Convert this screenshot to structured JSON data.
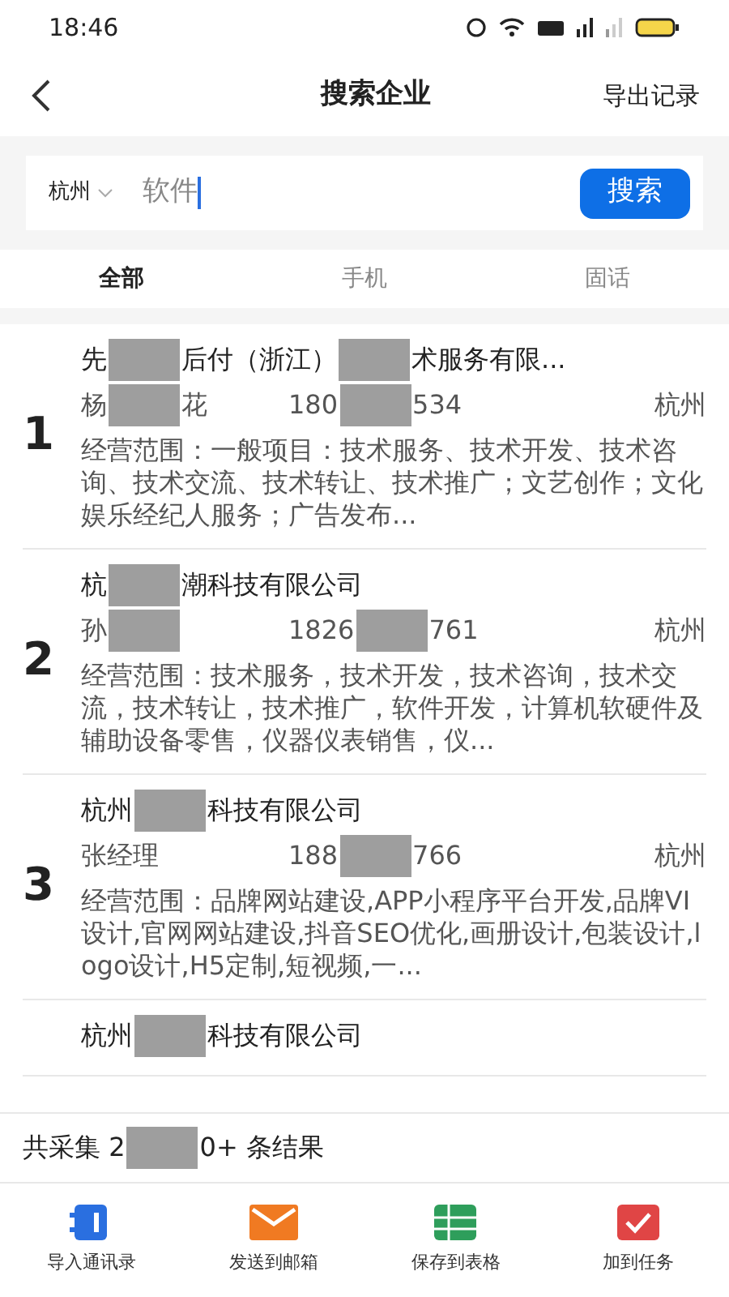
{
  "status_bar": {
    "time": "18:46"
  },
  "header": {
    "title": "搜索企业",
    "action": "导出记录"
  },
  "search": {
    "city": "杭州",
    "value": "软件",
    "button": "搜索"
  },
  "tabs": [
    {
      "label": "全部",
      "selected": true
    },
    {
      "label": "手机",
      "selected": false
    },
    {
      "label": "固话",
      "selected": false
    }
  ],
  "results": [
    {
      "index": "1",
      "title": [
        {
          "kind": "text",
          "text": "先"
        },
        {
          "kind": "redacted"
        },
        {
          "kind": "text",
          "text": "后付（浙江）"
        },
        {
          "kind": "redacted"
        },
        {
          "kind": "text",
          "text": "术服务有限..."
        }
      ],
      "contact": [
        {
          "kind": "text",
          "text": "杨"
        },
        {
          "kind": "redacted"
        },
        {
          "kind": "text",
          "text": "花"
        }
      ],
      "phone": [
        {
          "kind": "text",
          "text": "180"
        },
        {
          "kind": "redacted"
        },
        {
          "kind": "text",
          "text": "534"
        }
      ],
      "city": "杭州",
      "scope": "经营范围：一般项目：技术服务、技术开发、技术咨询、技术交流、技术转让、技术推广；文艺创作；文化娱乐经纪人服务；广告发布..."
    },
    {
      "index": "2",
      "title": [
        {
          "kind": "text",
          "text": "杭"
        },
        {
          "kind": "redacted"
        },
        {
          "kind": "text",
          "text": "潮科技有限公司"
        }
      ],
      "contact": [
        {
          "kind": "text",
          "text": "孙"
        },
        {
          "kind": "redacted"
        }
      ],
      "phone": [
        {
          "kind": "text",
          "text": "1826"
        },
        {
          "kind": "redacted"
        },
        {
          "kind": "text",
          "text": "761"
        }
      ],
      "city": "杭州",
      "scope": "经营范围：技术服务，技术开发，技术咨询，技术交流，技术转让，技术推广，软件开发，计算机软硬件及辅助设备零售，仪器仪表销售，仪..."
    },
    {
      "index": "3",
      "title": [
        {
          "kind": "text",
          "text": "杭州"
        },
        {
          "kind": "redacted"
        },
        {
          "kind": "text",
          "text": "科技有限公司"
        }
      ],
      "contact": [
        {
          "kind": "text",
          "text": "张经理"
        }
      ],
      "phone": [
        {
          "kind": "text",
          "text": "188"
        },
        {
          "kind": "redacted"
        },
        {
          "kind": "text",
          "text": "766"
        }
      ],
      "city": "杭州",
      "scope": "经营范围：品牌网站建设,APP小程序平台开发,品牌VI设计,官网网站建设,抖音SEO优化,画册设计,包装设计,logo设计,H5定制,短视频,一..."
    },
    {
      "title": [
        {
          "kind": "text",
          "text": "杭州"
        },
        {
          "kind": "redacted"
        },
        {
          "kind": "text",
          "text": "科技有限公司"
        }
      ]
    }
  ],
  "summary": [
    {
      "kind": "text",
      "text": "共采集 2"
    },
    {
      "kind": "redacted"
    },
    {
      "kind": "text",
      "text": "0+ 条结果"
    }
  ],
  "actions": [
    {
      "kind": "contacts",
      "label": "导入通讯录"
    },
    {
      "kind": "mail",
      "label": "发送到邮箱"
    },
    {
      "kind": "sheet",
      "label": "保存到表格"
    },
    {
      "kind": "task",
      "label": "加到任务"
    }
  ]
}
